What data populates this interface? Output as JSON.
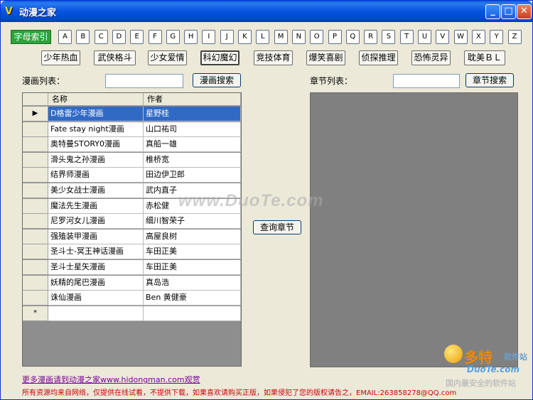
{
  "window": {
    "title": "动漫之家",
    "icon": "v-logo-icon",
    "controls": [
      "minimize",
      "maximize",
      "close"
    ]
  },
  "alpha_index_label": "字母索引",
  "letters": [
    "A",
    "B",
    "C",
    "D",
    "E",
    "F",
    "G",
    "H",
    "I",
    "J",
    "K",
    "L",
    "M",
    "N",
    "O",
    "P",
    "Q",
    "R",
    "S",
    "T",
    "U",
    "V",
    "W",
    "X",
    "Y",
    "Z"
  ],
  "categories": [
    "少年热血",
    "武侠格斗",
    "少女爱情",
    "科幻魔幻",
    "竞技体育",
    "爆笑喜剧",
    "侦探推理",
    "恐怖灵异",
    "耽美ＢＬ"
  ],
  "active_category": "科幻魔幻",
  "comic_list_label": "漫画列表：",
  "comic_search_button": "漫画搜索",
  "chapter_list_label": "章节列表：",
  "chapter_search_button": "章节搜索",
  "query_chapter_button": "查询章节",
  "grid": {
    "columns": [
      "名称",
      "作者"
    ],
    "rows": [
      {
        "name": "D格雷少年漫画",
        "author": "星野桂"
      },
      {
        "name": "Fate stay night漫画",
        "author": "山口祐司"
      },
      {
        "name": "奥特曼STORY0漫画",
        "author": "真船一雄"
      },
      {
        "name": "滑头鬼之孙漫画",
        "author": "椎桥宽"
      },
      {
        "name": "结界师漫画",
        "author": "田边伊卫郎"
      },
      {
        "name": "美少女战士漫画",
        "author": "武内直子"
      },
      {
        "name": "魔法先生漫画",
        "author": "赤松健"
      },
      {
        "name": "尼罗河女儿漫画",
        "author": "细川智荣子"
      },
      {
        "name": "强殖装甲漫画",
        "author": "高屋良树"
      },
      {
        "name": "圣斗士-冥王神话漫画",
        "author": "车田正美"
      },
      {
        "name": "圣斗士星矢漫画",
        "author": "车田正美"
      },
      {
        "name": "妖精的尾巴漫画",
        "author": "真岛浩"
      },
      {
        "name": "诛仙漫画",
        "author": "Ben 黄健豪"
      }
    ],
    "selected_row": 0,
    "new_row_marker": "*",
    "current_row_marker": "▶"
  },
  "footer_link": "更多漫画请到动漫之家www.hidongman.com观赏",
  "footer_notice": "所有资源均来自网络，仅提供在线试看，不提供下载，如果喜欢请购买正版，如果侵犯了您的版权请告之，EMAIL:263858278@QQ.com",
  "watermark": "www.DuoTe.com",
  "logo": {
    "big": "多特",
    "small1": "软件站",
    "small2": "DuoTe.com",
    "small3": "国内最安全的软件站"
  },
  "colors": {
    "titlebar": "#0a58e0",
    "alpha_index_bg": "#2ca33a",
    "selected_row": "#316ac5",
    "footer_notice": "#cc0000",
    "footer_link": "#7a0099"
  }
}
